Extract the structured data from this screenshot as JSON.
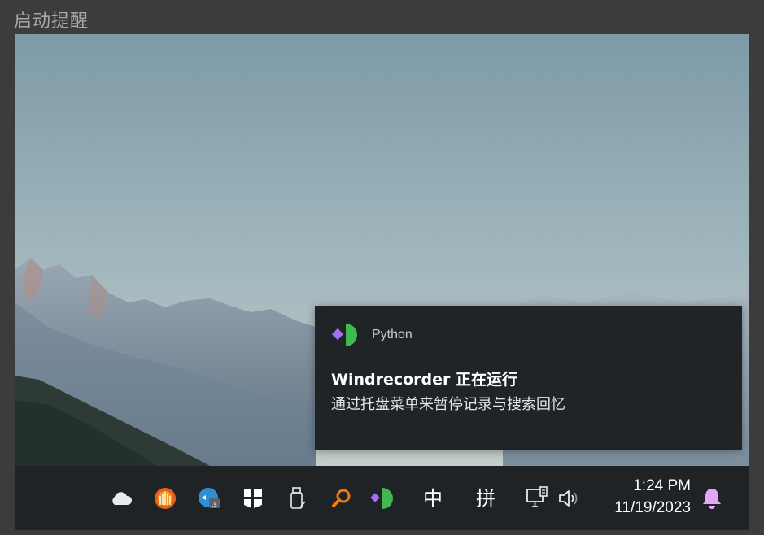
{
  "window": {
    "title": "启动提醒"
  },
  "toast": {
    "app_name": "Python",
    "title": "Windrecorder 正在运行",
    "body": "通过托盘菜单来暂停记录与搜索回忆"
  },
  "taskbar": {
    "tray_icons": [
      "onedrive-cloud-icon",
      "torrent-client-icon",
      "remote-connection-icon",
      "grid-app-icon",
      "usb-drive-icon",
      "search-app-icon",
      "windrecorder-icon"
    ],
    "ime_mode": "中",
    "ime_layout": "拼",
    "clock_time": "1:24 PM",
    "clock_date": "11/19/2023"
  },
  "colors": {
    "taskbar": "#1f2326",
    "toast": "#202427",
    "accent_purple": "#a371f7",
    "accent_green": "#3fb950",
    "bell": "#e6a6f7"
  }
}
